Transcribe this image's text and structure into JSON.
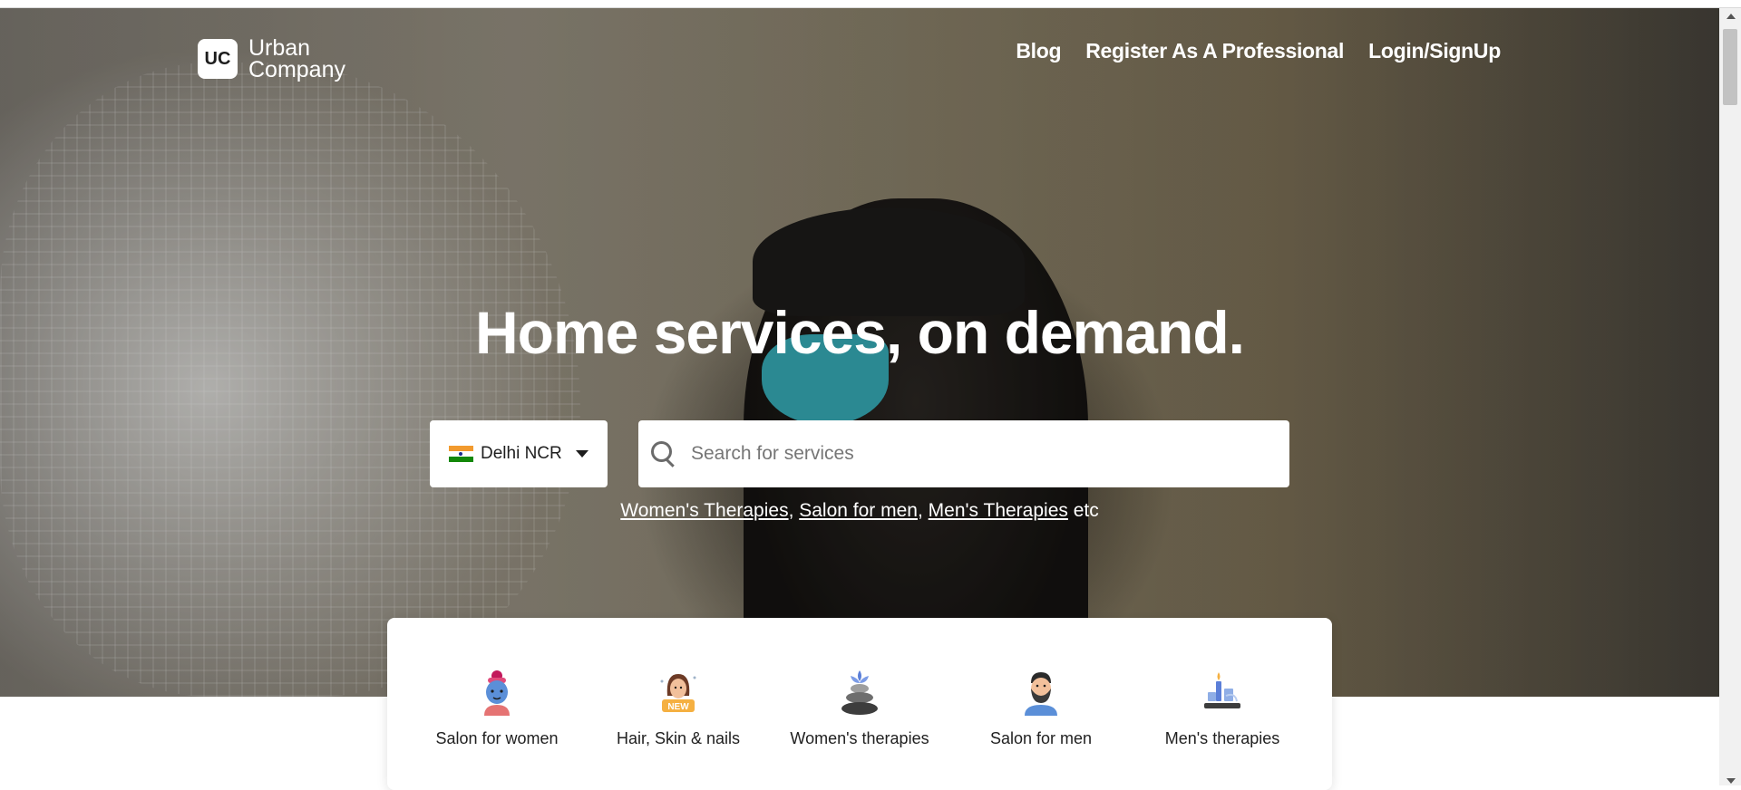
{
  "brand": {
    "mark": "UC",
    "line1": "Urban",
    "line2": "Company"
  },
  "nav": {
    "blog": "Blog",
    "register": "Register As A Professional",
    "login": "Login/SignUp"
  },
  "hero": {
    "headline": "Home services, on demand."
  },
  "city": {
    "label": "Delhi NCR"
  },
  "search": {
    "placeholder": "Search for services"
  },
  "suggestions": {
    "link1": "Women's Therapies",
    "sep1": ", ",
    "link2": "Salon for men",
    "sep2": ", ",
    "link3": "Men's Therapies",
    "suffix": " etc"
  },
  "categories": [
    {
      "label": "Salon for women",
      "icon": "woman-face-mask-icon"
    },
    {
      "label": "Hair, Skin & nails",
      "icon": "woman-new-badge-icon",
      "badge": "NEW"
    },
    {
      "label": "Women's therapies",
      "icon": "spa-stones-icon"
    },
    {
      "label": "Salon for men",
      "icon": "bearded-man-icon"
    },
    {
      "label": "Men's therapies",
      "icon": "candle-massage-icon"
    }
  ],
  "colors": {
    "accent": "#ffffff",
    "text": "#212121",
    "flag_saffron": "#f29a2e",
    "flag_green": "#138808"
  }
}
